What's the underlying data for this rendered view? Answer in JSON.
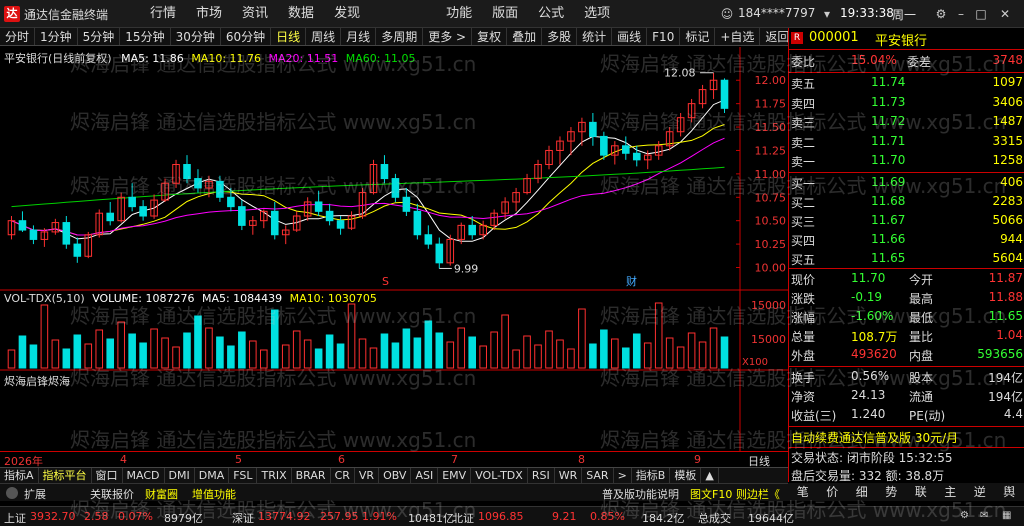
{
  "app": {
    "name": "通达信金融终端",
    "menu": [
      "行情",
      "市场",
      "资讯",
      "数据",
      "发现",
      "功能",
      "版面",
      "公式",
      "选项"
    ],
    "account": "184****7797",
    "time": "19:33:38",
    "weekday": "周一"
  },
  "periods": [
    "分时",
    "1分钟",
    "5分钟",
    "15分钟",
    "30分钟",
    "60分钟",
    "日线",
    "周线",
    "月线",
    "多周期",
    "更多 >"
  ],
  "tools": [
    "复权",
    "叠加",
    "多股",
    "统计",
    "画线",
    "F10",
    "标记",
    "+自选",
    "返回"
  ],
  "legend": {
    "title": "平安银行(日线前复权)",
    "ma5": "MA5: 11.86",
    "ma10": "MA10: 11.76",
    "ma20": "MA20: 11.51",
    "ma60": "MA60: 11.05"
  },
  "price_axis": [
    "12.00",
    "11.75",
    "11.50",
    "11.25",
    "11.00",
    "10.75",
    "10.50",
    "10.25",
    "10.00"
  ],
  "annotations": {
    "high": "12.08",
    "low": "9.99",
    "mark1": "S",
    "mark2": "财"
  },
  "volume": {
    "label": "VOL-TDX(5,10)",
    "vol": "VOLUME: 1087276",
    "ma5": "MA5: 1084439",
    "ma10": "MA10: 1030705",
    "axis": [
      "15000",
      "15000"
    ],
    "unit": "X100"
  },
  "indicator": {
    "label": "烬海启锋烬海"
  },
  "dates": [
    "2026年",
    "4",
    "5",
    "6",
    "7",
    "8",
    "9"
  ],
  "date_period": "日线",
  "tabs": [
    "指标A",
    "指标平台",
    "窗口",
    "MACD",
    "DMI",
    "DMA",
    "FSL",
    "TRIX",
    "BRAR",
    "CR",
    "VR",
    "OBV",
    "ASI",
    "EMV",
    "VOL-TDX",
    "RSI",
    "WR",
    "SAR",
    ">",
    "指标B",
    "模板",
    "▲"
  ],
  "infobar": {
    "expand": "扩展",
    "report": "关联报价",
    "wealth": "财富圈",
    "value": "增值功能",
    "f10": "普及版功能说明",
    "f10b": "图文F10 则边栏《"
  },
  "quote": {
    "code": "000001",
    "name": "平安银行",
    "ratio_label": "委比",
    "ratio": "15.04%",
    "diff_label": "委差",
    "diff": "3748",
    "asks": [
      {
        "l": "卖五",
        "p": "11.74",
        "v": "1097"
      },
      {
        "l": "卖四",
        "p": "11.73",
        "v": "3406"
      },
      {
        "l": "卖三",
        "p": "11.72",
        "v": "1487"
      },
      {
        "l": "卖二",
        "p": "11.71",
        "v": "3315"
      },
      {
        "l": "卖一",
        "p": "11.70",
        "v": "1258"
      }
    ],
    "bids": [
      {
        "l": "买一",
        "p": "11.69",
        "v": "406"
      },
      {
        "l": "买二",
        "p": "11.68",
        "v": "2283"
      },
      {
        "l": "买三",
        "p": "11.67",
        "v": "5066"
      },
      {
        "l": "买四",
        "p": "11.66",
        "v": "944"
      },
      {
        "l": "买五",
        "p": "11.65",
        "v": "5604"
      }
    ],
    "stats": [
      [
        "现价",
        "11.70",
        "今开",
        "11.87"
      ],
      [
        "涨跌",
        "-0.19",
        "最高",
        "11.88"
      ],
      [
        "涨幅",
        "-1.60%",
        "最低",
        "11.65"
      ],
      [
        "总量",
        "108.7万",
        "量比",
        "1.04"
      ],
      [
        "外盘",
        "493620",
        "内盘",
        "593656"
      ]
    ],
    "stats2": [
      [
        "换手",
        "0.56%",
        "股本",
        "194亿"
      ],
      [
        "净资",
        "24.13",
        "流通",
        "194亿"
      ],
      [
        "收益(三)",
        "1.240",
        "PE(动)",
        "4.4"
      ]
    ],
    "ad": "自动续费通达信普及版 30元/月",
    "trade": [
      "交易状态: 闭市阶段 15:32:55",
      "盘后交易量: 332 额: 38.8万"
    ],
    "rtabs": [
      "笔",
      "价",
      "细",
      "势",
      "联",
      "主",
      "逆",
      "舆"
    ]
  },
  "status": {
    "sh": "上证",
    "sh_v": "3932.70",
    "sh_c": "2.58",
    "sh_p": "0.07%",
    "sh_a": "8979亿",
    "sz": "深证",
    "sz_v": "13774.92",
    "sz_c": "257.95",
    "sz_p": "1.91%",
    "sz_a": "10481亿",
    "bz": "北证",
    "bz_v": "1096.85",
    "bz_c": "9.21",
    "bz_p": "0.85%",
    "bz_a": "184.2亿",
    "total": "总成交",
    "total_v": "19644亿"
  },
  "watermark": "烬海启锋 通达信选股指标公式 www.xg51.cn",
  "colors": {
    "up": "#ff3030",
    "down": "#00e0e0",
    "ma5": "#ffffff",
    "ma10": "#ffff00",
    "ma20": "#ff00ff",
    "ma60": "#00d000",
    "frame": "#cc0000"
  },
  "chart_data": {
    "type": "candlestick",
    "ohlc": [
      [
        10.35,
        10.55,
        10.3,
        10.5
      ],
      [
        10.5,
        10.6,
        10.38,
        10.4
      ],
      [
        10.4,
        10.45,
        10.25,
        10.3
      ],
      [
        10.3,
        10.42,
        10.22,
        10.38
      ],
      [
        10.38,
        10.52,
        10.35,
        10.48
      ],
      [
        10.48,
        10.55,
        10.2,
        10.25
      ],
      [
        10.25,
        10.32,
        10.05,
        10.12
      ],
      [
        10.12,
        10.38,
        10.1,
        10.35
      ],
      [
        10.35,
        10.62,
        10.32,
        10.58
      ],
      [
        10.58,
        10.7,
        10.45,
        10.5
      ],
      [
        10.5,
        10.8,
        10.48,
        10.75
      ],
      [
        10.75,
        10.9,
        10.6,
        10.65
      ],
      [
        10.65,
        10.72,
        10.5,
        10.55
      ],
      [
        10.55,
        10.78,
        10.52,
        10.72
      ],
      [
        10.72,
        10.95,
        10.7,
        10.9
      ],
      [
        10.9,
        11.15,
        10.85,
        11.1
      ],
      [
        11.1,
        11.2,
        10.9,
        10.95
      ],
      [
        10.95,
        11.05,
        10.8,
        10.85
      ],
      [
        10.85,
        10.98,
        10.75,
        10.92
      ],
      [
        10.92,
        10.98,
        10.7,
        10.75
      ],
      [
        10.75,
        10.85,
        10.6,
        10.65
      ],
      [
        10.65,
        10.72,
        10.4,
        10.45
      ],
      [
        10.45,
        10.55,
        10.35,
        10.5
      ],
      [
        10.5,
        10.62,
        10.42,
        10.6
      ],
      [
        10.6,
        10.7,
        10.3,
        10.35
      ],
      [
        10.35,
        10.45,
        10.25,
        10.4
      ],
      [
        10.4,
        10.6,
        10.38,
        10.55
      ],
      [
        10.55,
        10.75,
        10.5,
        10.7
      ],
      [
        10.7,
        10.82,
        10.55,
        10.6
      ],
      [
        10.6,
        10.68,
        10.45,
        10.5
      ],
      [
        10.5,
        10.55,
        10.35,
        10.42
      ],
      [
        10.42,
        10.6,
        10.4,
        10.55
      ],
      [
        10.55,
        10.85,
        10.52,
        10.8
      ],
      [
        10.8,
        11.15,
        10.78,
        11.1
      ],
      [
        11.1,
        11.2,
        10.9,
        10.95
      ],
      [
        10.95,
        11.0,
        10.7,
        10.75
      ],
      [
        10.75,
        10.85,
        10.55,
        10.6
      ],
      [
        10.6,
        10.68,
        10.3,
        10.35
      ],
      [
        10.35,
        10.45,
        10.2,
        10.25
      ],
      [
        10.25,
        10.32,
        9.99,
        10.05
      ],
      [
        10.05,
        10.35,
        10.02,
        10.3
      ],
      [
        10.3,
        10.48,
        10.25,
        10.45
      ],
      [
        10.45,
        10.55,
        10.3,
        10.35
      ],
      [
        10.35,
        10.5,
        10.3,
        10.45
      ],
      [
        10.45,
        10.62,
        10.4,
        10.58
      ],
      [
        10.58,
        10.75,
        10.52,
        10.7
      ],
      [
        10.7,
        10.85,
        10.6,
        10.8
      ],
      [
        10.8,
        11.0,
        10.78,
        10.95
      ],
      [
        10.95,
        11.15,
        10.9,
        11.1
      ],
      [
        11.1,
        11.3,
        11.05,
        11.25
      ],
      [
        11.25,
        11.4,
        11.1,
        11.35
      ],
      [
        11.35,
        11.5,
        11.2,
        11.45
      ],
      [
        11.45,
        11.6,
        11.3,
        11.55
      ],
      [
        11.55,
        11.65,
        11.3,
        11.4
      ],
      [
        11.4,
        11.45,
        11.15,
        11.2
      ],
      [
        11.2,
        11.35,
        11.1,
        11.3
      ],
      [
        11.3,
        11.4,
        11.15,
        11.22
      ],
      [
        11.22,
        11.3,
        11.08,
        11.15
      ],
      [
        11.15,
        11.25,
        11.05,
        11.2
      ],
      [
        11.2,
        11.35,
        11.15,
        11.3
      ],
      [
        11.3,
        11.5,
        11.25,
        11.45
      ],
      [
        11.45,
        11.65,
        11.4,
        11.6
      ],
      [
        11.6,
        11.8,
        11.55,
        11.75
      ],
      [
        11.75,
        11.95,
        11.7,
        11.9
      ],
      [
        11.9,
        12.08,
        11.8,
        12.0
      ],
      [
        12.0,
        12.02,
        11.65,
        11.7
      ]
    ]
  }
}
